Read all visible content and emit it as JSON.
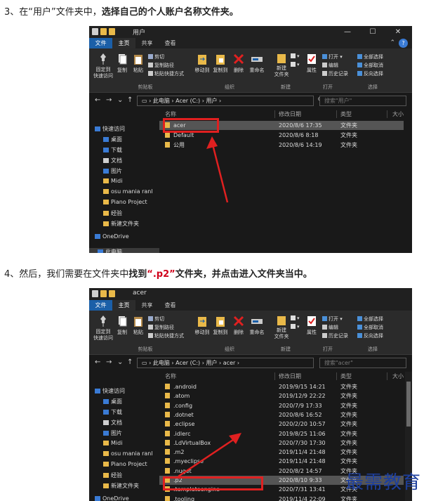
{
  "steps": {
    "step3": {
      "prefix": "3、在“用户”文件夹中，",
      "bold": "选择自己的个人账户名称文件夹。"
    },
    "step4": {
      "prefix": "4、然后，我们需要在文件夹中",
      "bold1": "找到",
      "quote_open": "“",
      "red": ".p2",
      "quote_close": "”",
      "bold2": "文件夹，并点击进入文件夹当中。"
    }
  },
  "window1": {
    "title": "用户",
    "controls": {
      "min": "—",
      "max": "☐",
      "close": "✕"
    },
    "tabs": {
      "file": "文件",
      "home": "主页",
      "share": "共享",
      "view": "查看"
    },
    "help": "?",
    "ribbon": {
      "pin": "固定到\n快速访问",
      "copy": "复制",
      "paste": "粘贴",
      "cut": "剪切",
      "copy_path": "复制路径",
      "paste_shortcut": "粘贴快捷方式",
      "move_to": "移动到",
      "copy_to": "复制到",
      "delete": "删除",
      "rename": "重命名",
      "new_folder": "新建\n文件夹",
      "properties": "属性",
      "open": "打开",
      "edit": "编辑",
      "history": "历史记录",
      "select_all": "全部选择",
      "select_none": "全部取消",
      "invert": "反向选择",
      "groups": {
        "clipboard": "剪贴板",
        "organize": "组织",
        "new": "新建",
        "open": "打开",
        "select": "选择"
      }
    },
    "address": [
      "此电脑",
      "Acer (C:)",
      "用户"
    ],
    "search_placeholder": "搜索\"用户\"",
    "columns": {
      "name": "名称",
      "date": "修改日期",
      "type": "类型",
      "size": "大小"
    },
    "nav": [
      {
        "label": "快速访问",
        "pinned": false
      },
      {
        "label": "桌面",
        "pinned": true
      },
      {
        "label": "下载",
        "pinned": true
      },
      {
        "label": "文档",
        "pinned": true
      },
      {
        "label": "图片",
        "pinned": true
      },
      {
        "label": "Midi",
        "pinned": true
      },
      {
        "label": "osu mania ranl",
        "pinned": false
      },
      {
        "label": "Piano Project",
        "pinned": false
      },
      {
        "label": "经验",
        "pinned": false
      },
      {
        "label": "新建文件夹",
        "pinned": false
      },
      {
        "label": "OneDrive",
        "pinned": false
      },
      {
        "label": "此电脑",
        "pinned": false
      }
    ],
    "pin_glyph": "📌",
    "rows": [
      {
        "name": "acer",
        "date": "2020/8/6 17:35",
        "type": "文件夹"
      },
      {
        "name": "Default",
        "date": "2020/8/6 8:18",
        "type": "文件夹"
      },
      {
        "name": "公用",
        "date": "2020/8/6 14:19",
        "type": "文件夹"
      }
    ]
  },
  "window2": {
    "title": "acer",
    "address": [
      "此电脑",
      "Acer (C:)",
      "用户",
      "acer"
    ],
    "search_placeholder": "搜索\"acer\"",
    "rows": [
      {
        "name": ".android",
        "date": "2019/9/15 14:21",
        "type": "文件夹"
      },
      {
        "name": ".atom",
        "date": "2019/12/9 22:22",
        "type": "文件夹"
      },
      {
        "name": ".config",
        "date": "2020/7/9 17:33",
        "type": "文件夹"
      },
      {
        "name": ".dotnet",
        "date": "2020/8/6 16:52",
        "type": "文件夹"
      },
      {
        "name": ".eclipse",
        "date": "2020/2/20 10:57",
        "type": "文件夹"
      },
      {
        "name": ".idlerc",
        "date": "2019/8/25 11:06",
        "type": "文件夹"
      },
      {
        "name": ".LdVirtualBox",
        "date": "2020/7/30 17:30",
        "type": "文件夹"
      },
      {
        "name": ".m2",
        "date": "2019/11/4 21:48",
        "type": "文件夹"
      },
      {
        "name": ".myeclipse",
        "date": "2019/11/4 21:48",
        "type": "文件夹"
      },
      {
        "name": ".nuget",
        "date": "2020/8/2 14:57",
        "type": "文件夹"
      },
      {
        "name": ".p2",
        "date": "2020/8/10 9:33",
        "type": "文件夹"
      },
      {
        "name": ".templateengine",
        "date": "2020/7/31 13:41",
        "type": "文件夹"
      },
      {
        "name": ".tooling",
        "date": "2019/11/4 22:09",
        "type": "文件夹"
      }
    ]
  },
  "watermark": "最需教育",
  "colors": {
    "accent": "#1b5fa8",
    "highlight_red": "#e02020",
    "folder": "#e9b949"
  }
}
